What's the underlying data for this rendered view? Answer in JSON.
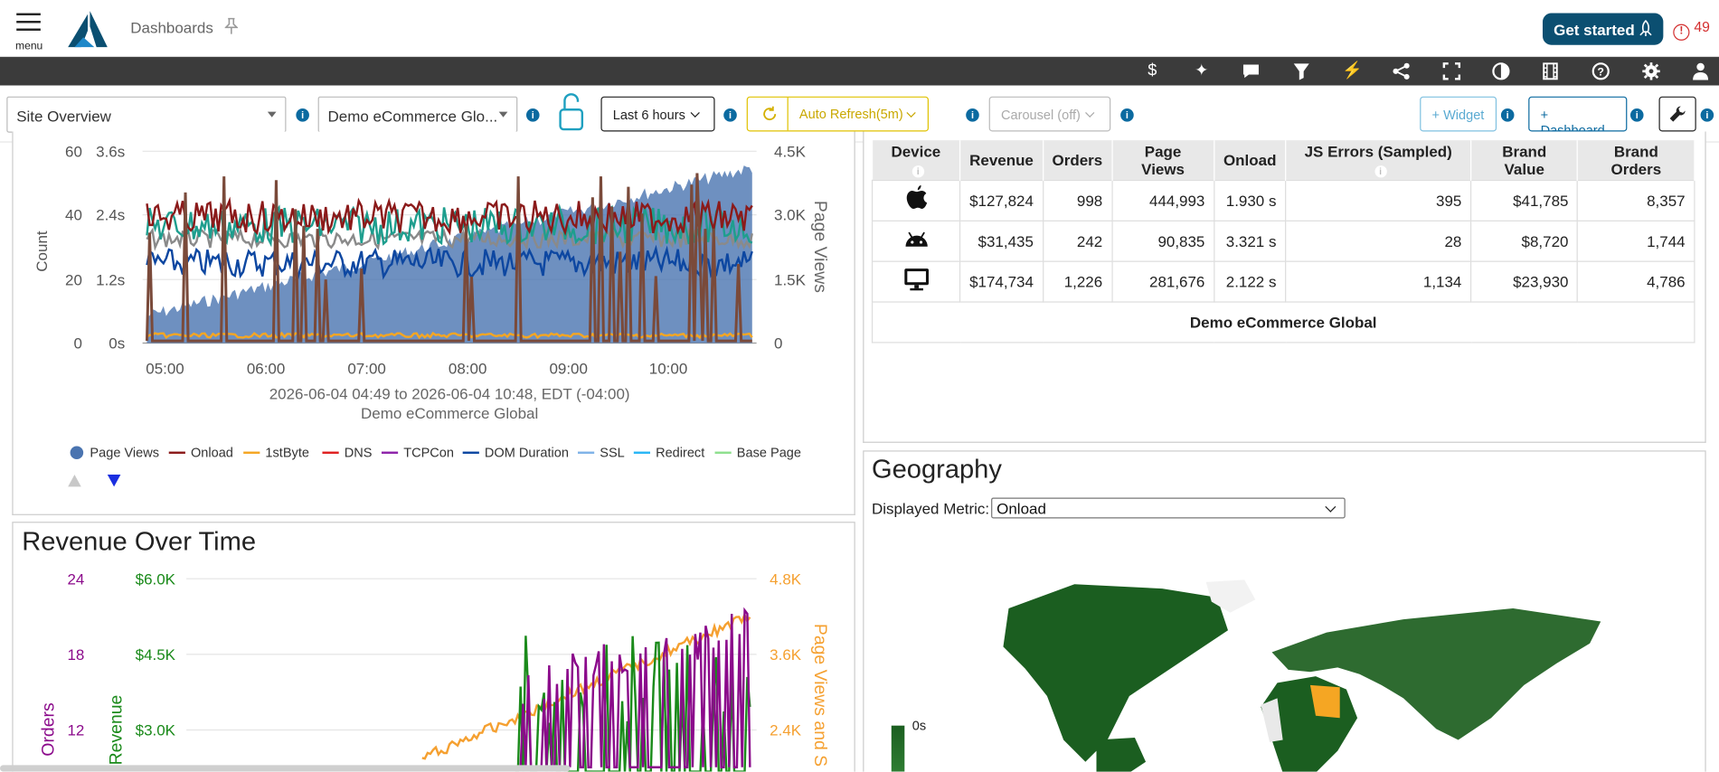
{
  "header": {
    "menu_label": "menu",
    "breadcrumb": "Dashboards",
    "get_started": "Get started",
    "alert_count": "49",
    "alert_symbol": "!"
  },
  "toolbar_icons": [
    "dollar-icon",
    "sparkle-icon",
    "comment-icon",
    "filter-icon",
    "bolt-icon",
    "share-icon",
    "fullscreen-icon",
    "contrast-icon",
    "film-icon",
    "help-icon",
    "gear-icon",
    "user-icon"
  ],
  "filters": {
    "dashboard": "Site Overview",
    "app": "Demo eCommerce Glo...",
    "time_range": "Last 6 hours",
    "auto_refresh": "Auto Refresh(5m)",
    "carousel": "Carousel (off)",
    "add_widget": "+ Widget",
    "add_dashboard": "+ Dashboard"
  },
  "timing_chart": {
    "left_axis_title": "Count",
    "left_ticks": [
      "60",
      "40",
      "20",
      "0"
    ],
    "mid_ticks": [
      "3.6s",
      "2.4s",
      "1.2s",
      "0s"
    ],
    "right_ticks": [
      "4.5K",
      "3.0K",
      "1.5K",
      "0"
    ],
    "right_axis_title": "Page Views",
    "x_ticks": [
      "05:00",
      "06:00",
      "07:00",
      "08:00",
      "09:00",
      "10:00"
    ],
    "range_label": "2026-06-04 04:49 to 2026-06-04 10:48, EDT (-04:00)",
    "app_label": "Demo eCommerce Global",
    "legend": [
      {
        "name": "Page Views",
        "color": "#4a74b0"
      },
      {
        "name": "Onload",
        "color": "#8b1a1a"
      },
      {
        "name": "1stByte",
        "color": "#f5a623"
      },
      {
        "name": "DNS",
        "color": "#e02020"
      },
      {
        "name": "TCPCon",
        "color": "#8e24aa"
      },
      {
        "name": "DOM Duration",
        "color": "#0d47a1"
      },
      {
        "name": "SSL",
        "color": "#7fb3e8"
      },
      {
        "name": "Redirect",
        "color": "#29b6f6"
      },
      {
        "name": "Base Page",
        "color": "#8ee08e"
      }
    ]
  },
  "device_table": {
    "columns": [
      "Device",
      "Revenue",
      "Orders",
      "Page Views",
      "Onload",
      "JS Errors (Sampled)",
      "Brand Value",
      "Brand Orders"
    ],
    "rows": [
      {
        "device": "apple-icon",
        "revenue": "$127,824",
        "orders": "998",
        "page_views": "444,993",
        "onload": "1.930 s",
        "js_errors": "395",
        "brand_value": "$41,785",
        "brand_orders": "8,357"
      },
      {
        "device": "android-icon",
        "revenue": "$31,435",
        "orders": "242",
        "page_views": "90,835",
        "onload": "3.321 s",
        "js_errors": "28",
        "brand_value": "$8,720",
        "brand_orders": "1,744"
      },
      {
        "device": "desktop-icon",
        "revenue": "$174,734",
        "orders": "1,226",
        "page_views": "281,676",
        "onload": "2.122 s",
        "js_errors": "1,134",
        "brand_value": "$23,930",
        "brand_orders": "4,786"
      }
    ],
    "footer": "Demo eCommerce Global"
  },
  "revenue_chart": {
    "title": "Revenue Over Time",
    "orders_title": "Orders",
    "revenue_title": "Revenue",
    "right_title": "Page Views and S",
    "orders_ticks": [
      "24",
      "18",
      "12"
    ],
    "revenue_ticks": [
      "$6.0K",
      "$4.5K",
      "$3.0K"
    ],
    "right_ticks": [
      "4.8K",
      "3.6K",
      "2.4K"
    ]
  },
  "geography": {
    "title": "Geography",
    "metric_label": "Displayed Metric:",
    "metric_value": "Onload",
    "scale_label": "0s"
  }
}
